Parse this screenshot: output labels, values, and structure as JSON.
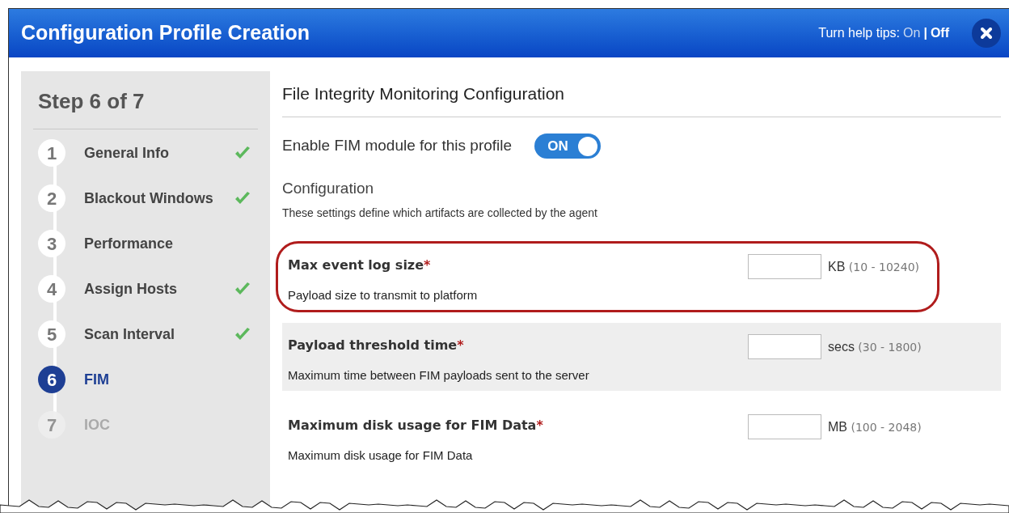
{
  "window": {
    "title": "Configuration Profile Creation"
  },
  "help_tips": {
    "label": "Turn help tips:",
    "separator": "|",
    "options": [
      {
        "label": "On",
        "selected": false
      },
      {
        "label": "Off",
        "selected": true
      }
    ]
  },
  "sidebar": {
    "title": "Step 6 of 7",
    "steps": [
      {
        "number": "1",
        "label": "General Info",
        "checked": true,
        "selected": false,
        "disabled": false
      },
      {
        "number": "2",
        "label": "Blackout Windows",
        "checked": true,
        "selected": false,
        "disabled": false
      },
      {
        "number": "3",
        "label": "Performance",
        "checked": false,
        "selected": false,
        "disabled": false
      },
      {
        "number": "4",
        "label": "Assign Hosts",
        "checked": true,
        "selected": false,
        "disabled": false
      },
      {
        "number": "5",
        "label": "Scan Interval",
        "checked": true,
        "selected": false,
        "disabled": false
      },
      {
        "number": "6",
        "label": "FIM",
        "checked": false,
        "selected": true,
        "disabled": false
      },
      {
        "number": "7",
        "label": "IOC",
        "checked": false,
        "selected": false,
        "disabled": true
      }
    ]
  },
  "content": {
    "title": "File Integrity Monitoring Configuration",
    "enable": {
      "label": "Enable FIM module for this profile",
      "on": true,
      "toggle_text": "ON"
    },
    "section": {
      "title": "Configuration",
      "subtitle": "These settings define which artifacts are collected by the agent"
    },
    "fields": [
      {
        "label": "Max event log size",
        "required_mark": "*",
        "description": "Payload size to transmit to platform",
        "unit": "KB",
        "range": "(10 - 10240)",
        "shaded": false,
        "highlighted": true
      },
      {
        "label": "Payload threshold time",
        "required_mark": "*",
        "description": "Maximum time between FIM payloads sent to the server",
        "unit": "secs",
        "range": "(30 - 1800)",
        "shaded": true,
        "highlighted": false
      },
      {
        "label": "Maximum disk usage for FIM Data",
        "required_mark": "*",
        "description": "Maximum disk usage for FIM Data",
        "unit": "MB",
        "range": "(100 - 2048)",
        "shaded": false,
        "highlighted": false
      }
    ]
  }
}
